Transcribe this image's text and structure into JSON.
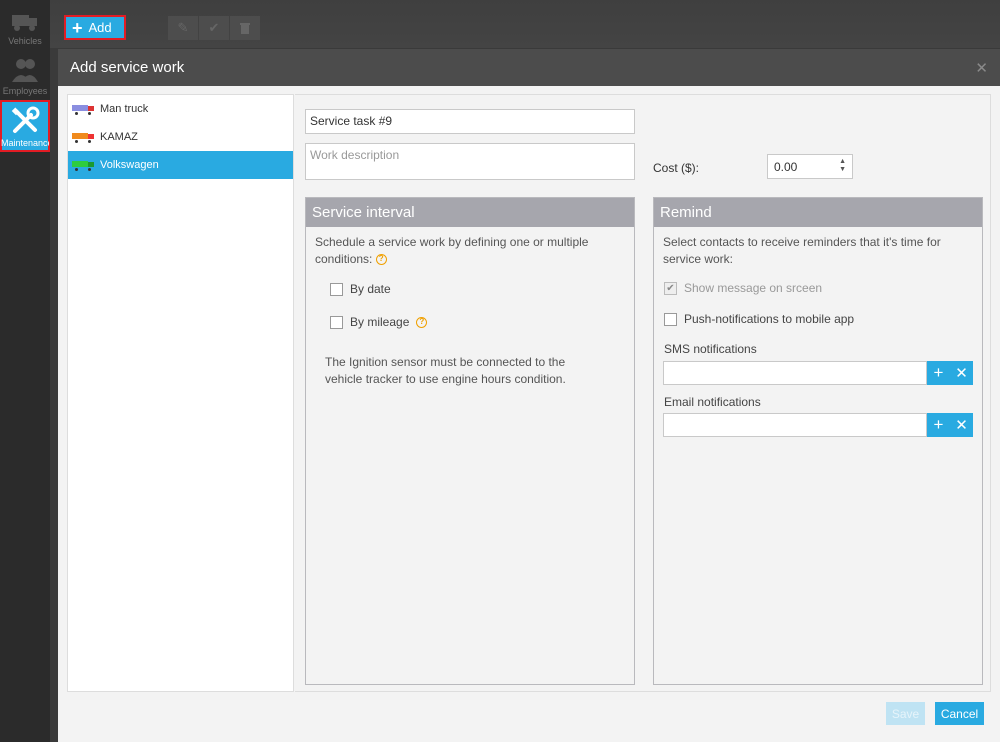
{
  "sidebar": {
    "items": [
      {
        "label": "Vehicles",
        "icon": "truck-icon"
      },
      {
        "label": "Employees",
        "icon": "people-icon"
      },
      {
        "label": "Maintenance",
        "icon": "tools-icon",
        "active": true
      }
    ]
  },
  "toolbar": {
    "add_label": "Add"
  },
  "modal": {
    "title": "Add service work",
    "vehicles": [
      {
        "name": "Man truck",
        "color": "#8a8ee0"
      },
      {
        "name": "KAMAZ",
        "color": "#f08a1c"
      },
      {
        "name": "Volkswagen",
        "color": "#2ecc40"
      }
    ],
    "task_name_value": "Service task #9",
    "description_placeholder": "Work description",
    "cost_label": "Cost ($):",
    "cost_value": "0.00",
    "service_interval": {
      "title": "Service interval",
      "intro": "Schedule a service work by defining one or multiple conditions:",
      "by_date": "By date",
      "by_mileage": "By mileage",
      "note": "The Ignition sensor must be connected to the vehicle tracker to use engine hours condition."
    },
    "remind": {
      "title": "Remind",
      "intro": "Select contacts to receive reminders that it's time for service work:",
      "show_message": "Show message on srceen",
      "push": "Push-notifications to mobile app",
      "sms_label": "SMS notifications",
      "email_label": "Email notifications"
    },
    "save_label": "Save",
    "cancel_label": "Cancel"
  },
  "colors": {
    "accent": "#29aae1",
    "highlight_border": "#e21c24"
  }
}
